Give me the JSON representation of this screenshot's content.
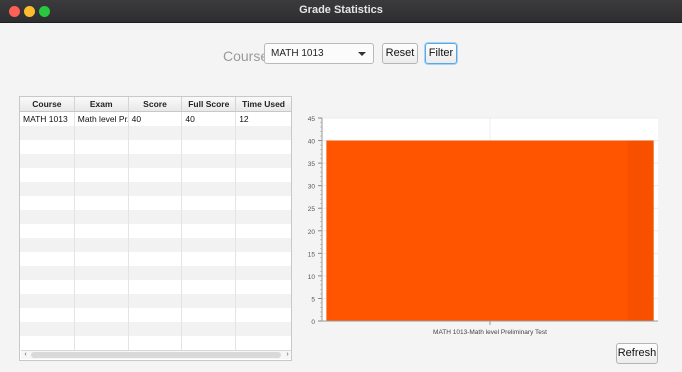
{
  "window": {
    "title": "Grade Statistics"
  },
  "filter": {
    "course_label": "Course",
    "course_value": "MATH 1013",
    "reset_label": "Reset",
    "filter_label": "Filter"
  },
  "table": {
    "columns": [
      "Course",
      "Exam",
      "Score",
      "Full Score",
      "Time Used"
    ],
    "rows": [
      [
        "MATH 1013",
        "Math level Pr...",
        "40",
        "40",
        "12"
      ]
    ]
  },
  "refresh_label": "Refresh",
  "colors": {
    "bar": "#ff5500",
    "accent": "#58a8e4"
  },
  "chart_data": {
    "type": "bar",
    "categories": [
      "MATH 1013-Math level Preliminary Test"
    ],
    "values": [
      40
    ],
    "ylim": [
      0,
      45
    ],
    "yticks": [
      0,
      5,
      10,
      15,
      20,
      25,
      30,
      35,
      40,
      45
    ],
    "title": "",
    "xlabel": "",
    "ylabel": "",
    "grid": true
  }
}
